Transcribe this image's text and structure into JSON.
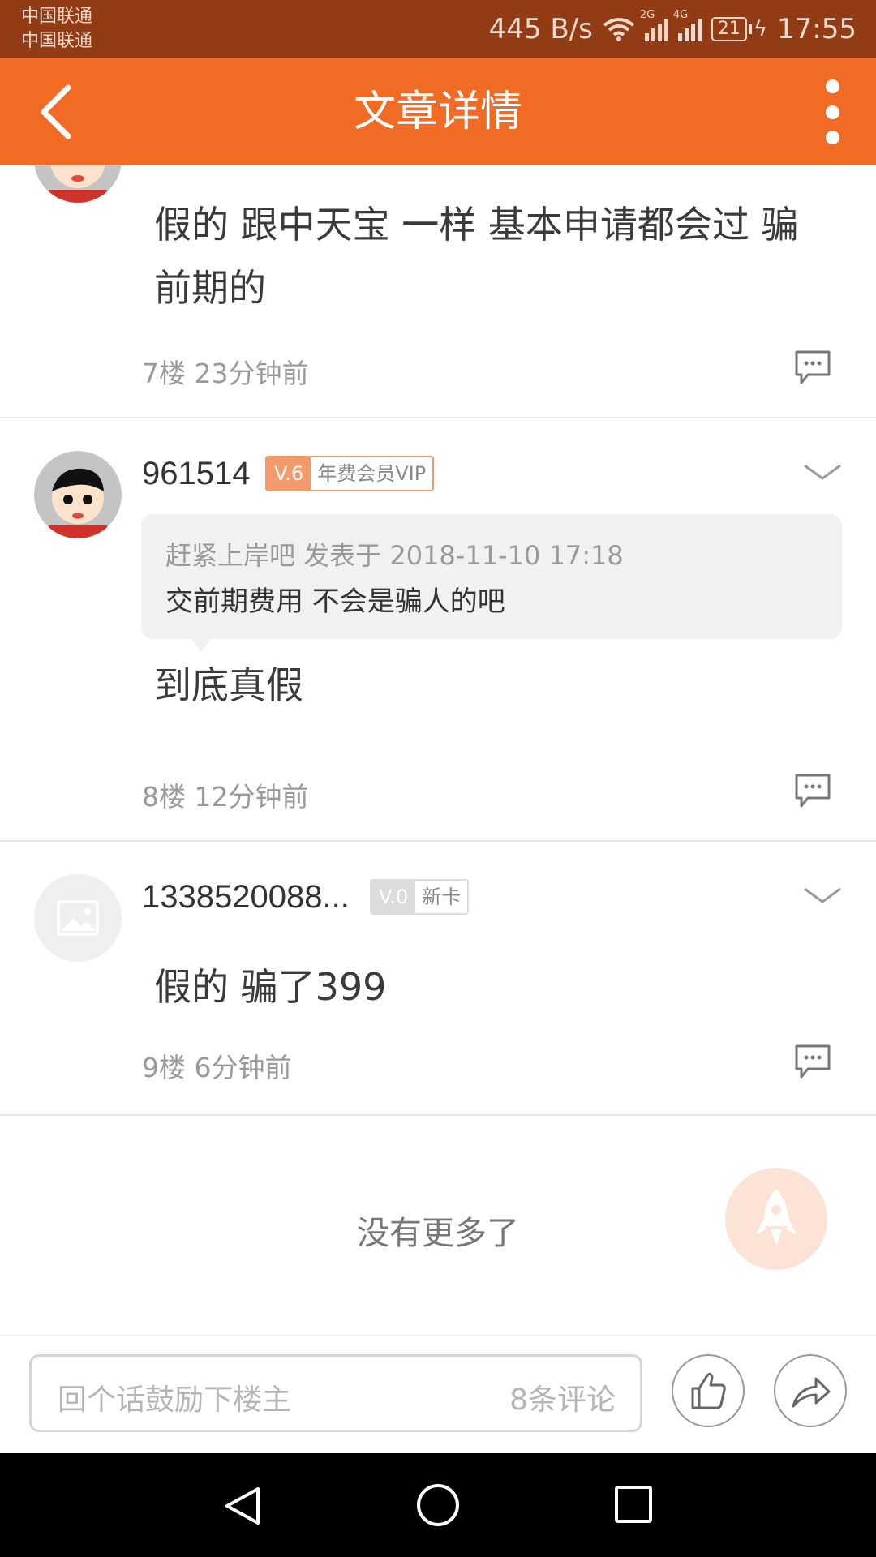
{
  "status_bar": {
    "carrier_1": "中国联通",
    "carrier_2": "中国联通",
    "net_speed": "445 B/s",
    "signal_1_label": "2G",
    "signal_2_label": "4G",
    "battery": "21",
    "time": "17:55"
  },
  "header": {
    "title": "文章详情"
  },
  "comments": [
    {
      "text": "假的 跟中天宝 一样 基本申请都会过 骗前期的",
      "floor": "7楼",
      "time": "23分钟前"
    },
    {
      "username": "961514",
      "level": "V.6",
      "badge": "年费会员VIP",
      "quote_meta": "赶紧上岸吧 发表于 2018-11-10 17:18",
      "quote_text": "交前期费用 不会是骗人的吧",
      "text": "到底真假",
      "floor": "8楼",
      "time": "12分钟前"
    },
    {
      "username": "1338520088...",
      "level": "V.0",
      "badge": "新卡",
      "text": "假的 骗了399",
      "floor": "9楼",
      "time": "6分钟前"
    }
  ],
  "footer_text": "没有更多了",
  "bottom_bar": {
    "input_placeholder": "回个话鼓励下楼主",
    "comment_count": "8条评论"
  },
  "colors": {
    "status_bar": "#923c15",
    "header": "#f26b25",
    "level_badge": "#f29a6c",
    "rocket_bg": "#fde3d6"
  },
  "icons": [
    "back-arrow-icon",
    "more-vert-icon",
    "chevron-down-icon",
    "comment-bubble-icon",
    "rocket-icon",
    "thumbs-up-icon",
    "share-icon",
    "nav-back-icon",
    "nav-home-icon",
    "nav-recents-icon"
  ]
}
